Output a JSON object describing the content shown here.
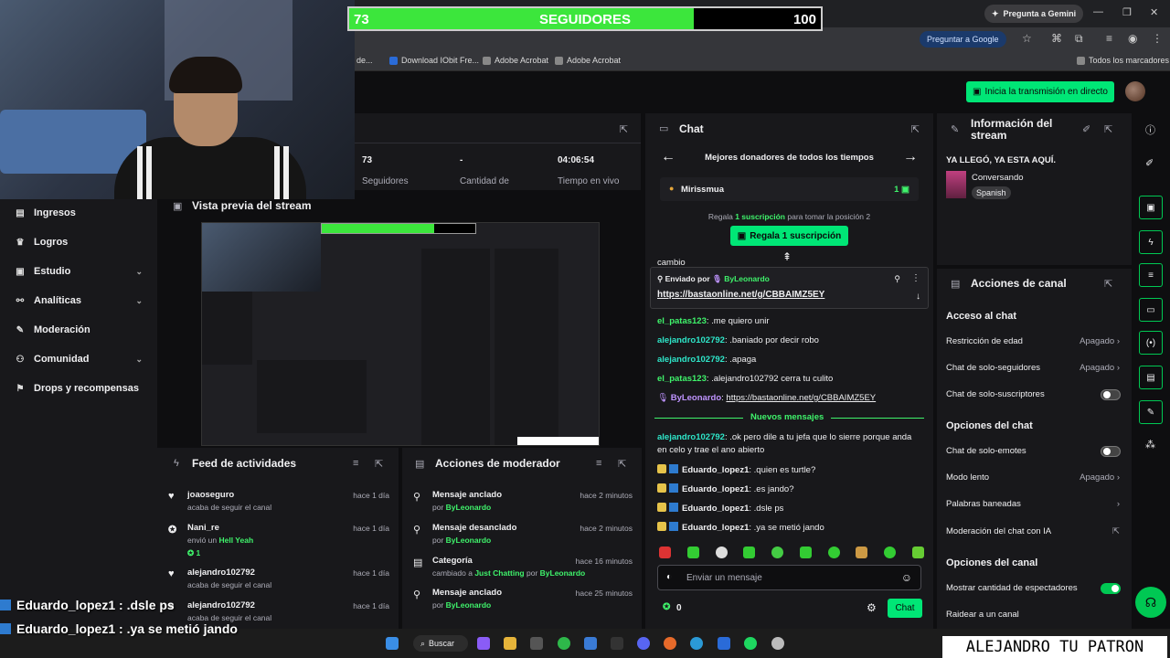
{
  "browser": {
    "gemini_button": "Pregunta a Gemini",
    "ask_google": "Preguntar a Google",
    "bookmarks": [
      "de...",
      "Download IObit Fre...",
      "Adobe Acrobat",
      "Adobe Acrobat"
    ],
    "all_bookmarks": "Todos los marcadores"
  },
  "follower_goal": {
    "current": "73",
    "label": "SEGUIDORES",
    "goal": "100",
    "progress_fraction": 0.73
  },
  "header": {
    "go_live": "Inicia la transmisión en directo"
  },
  "nav": [
    {
      "label": "Ingresos",
      "icon": "money-icon",
      "chevron": false
    },
    {
      "label": "Logros",
      "icon": "trophy-icon",
      "chevron": false
    },
    {
      "label": "Estudio",
      "icon": "studio-icon",
      "chevron": true
    },
    {
      "label": "Analíticas",
      "icon": "analytics-icon",
      "chevron": true
    },
    {
      "label": "Moderación",
      "icon": "wrench-icon",
      "chevron": false
    },
    {
      "label": "Comunidad",
      "icon": "community-icon",
      "chevron": true
    },
    {
      "label": "Drops y recompensas",
      "icon": "drops-icon",
      "chevron": false
    }
  ],
  "stats": [
    {
      "value": "73",
      "label": "Seguidores"
    },
    {
      "value": "-",
      "label": "Cantidad de"
    },
    {
      "value": "04:06:54",
      "label": "Tiempo en vivo"
    }
  ],
  "preview": {
    "title": "Vista previa del stream"
  },
  "feed": {
    "title": "Feed de actividades",
    "items": [
      {
        "user": "joaoseguro",
        "text": "acaba de seguir el canal",
        "time": "hace 1 día",
        "icon": "heart-icon"
      },
      {
        "user": "Nani_re",
        "text": "envió un ",
        "highlight": "Hell Yeah",
        "extra": "1",
        "time": "hace 1 día",
        "icon": "bits-icon"
      },
      {
        "user": "alejandro102792",
        "text": "acaba de seguir el canal",
        "time": "hace 1 día",
        "icon": "heart-icon"
      },
      {
        "user": "alejandro102792",
        "text": "acaba de seguir el canal",
        "time": "hace 1 día",
        "icon": "heart-icon"
      }
    ]
  },
  "modactions": {
    "title": "Acciones de moderador",
    "items": [
      {
        "action": "Mensaje anclado",
        "by": "por ",
        "who": "ByLeonardo",
        "time": "hace 2 minutos",
        "icon": "pin-icon"
      },
      {
        "action": "Mensaje desanclado",
        "by": "por ",
        "who": "ByLeonardo",
        "time": "hace 2 minutos",
        "icon": "unpin-icon"
      },
      {
        "action": "Categoría",
        "by": "cambiado a ",
        "who": "Just Chatting",
        "by2": " por ",
        "who2": "ByLeonardo",
        "time": "hace 16 minutos",
        "icon": "category-icon"
      },
      {
        "action": "Mensaje anclado",
        "by": "por ",
        "who": "ByLeonardo",
        "time": "hace 25 minutos",
        "icon": "pin-icon"
      }
    ]
  },
  "chat": {
    "title": "Chat",
    "leaderboard_title": "Mejores donadores de todos los tiempos",
    "top_donor": "Mirissmua",
    "top_donor_count": "1",
    "gift_hint_pre": "Regala ",
    "gift_hint_sub": "1 suscripción",
    "gift_hint_post": " para tomar la posición 2",
    "gift_button": "Regala 1 suscripción",
    "partial_msg": "cambio",
    "pinned_by": "Enviado por ",
    "pinned_user": "ByLeonardo",
    "pinned_link": "https://bastaonline.net/g/CBBAIMZ5EY",
    "messages": [
      {
        "user": "el_patas123",
        "text": ": .me quiero unir",
        "color": "#3ff36b"
      },
      {
        "user": "alejandro102792",
        "text": ": .baniado por decir robo",
        "color": "#2ee6c9"
      },
      {
        "user": "alejandro102792",
        "text": ": .apaga",
        "color": "#2ee6c9"
      },
      {
        "user": "el_patas123",
        "text": ": .alejandro102792 cerra tu culito",
        "color": "#3ff36b"
      }
    ],
    "link_msg_user": "ByLeonardo",
    "link_msg_link": "https://bastaonline.net/g/CBBAIMZ5EY",
    "new_messages": "Nuevos mensajes",
    "new_msg1_user": "alejandro102792",
    "new_msg1_text": ": .ok pero dile a tu jefa que lo sierre porque anda en celo y trae el ano abierto",
    "eduardo_msgs": [
      {
        "user": "Eduardo_lopez1",
        "text": ": .quien es turtle?"
      },
      {
        "user": "Eduardo_lopez1",
        "text": ": .es jando?"
      },
      {
        "user": "Eduardo_lopez1",
        "text": ": .dsle ps"
      },
      {
        "user": "Eduardo_lopez1",
        "text": ": .ya se metió jando"
      }
    ],
    "input_placeholder": "Enviar un mensaje",
    "points": "0",
    "send": "Chat"
  },
  "info": {
    "title": "Información del stream",
    "stream_title": "YA LLEGÓ, YA ESTA AQUÍ.",
    "category": "Conversando",
    "tag": "Spanish"
  },
  "actions": {
    "title": "Acciones de canal",
    "chat_access": "Acceso al chat",
    "age": "Restricción de edad",
    "age_val": "Apagado",
    "followers_only": "Chat de solo-seguidores",
    "followers_val": "Apagado",
    "subs_only": "Chat de solo-suscriptores",
    "chat_options": "Opciones del chat",
    "emotes_only": "Chat de solo-emotes",
    "slow_mode": "Modo lento",
    "slow_val": "Apagado",
    "banned_words": "Palabras baneadas",
    "ai_mod": "Moderación del chat con IA",
    "channel_options": "Opciones del canal",
    "show_viewers": "Mostrar cantidad de espectadores",
    "raid": "Raidear a un canal"
  },
  "overlay": {
    "line1": "Eduardo_lopez1 : .dsle ps",
    "line2": "Eduardo_lopez1 : .ya se metió jando",
    "watermark": "ALEJANDRO TU PATRON"
  },
  "taskbar": {
    "search": "Buscar"
  },
  "colors": {
    "accent": "#00e676",
    "twitch_purple": "#bf94ff",
    "background": "#0e0e10",
    "panel": "#18181b"
  }
}
